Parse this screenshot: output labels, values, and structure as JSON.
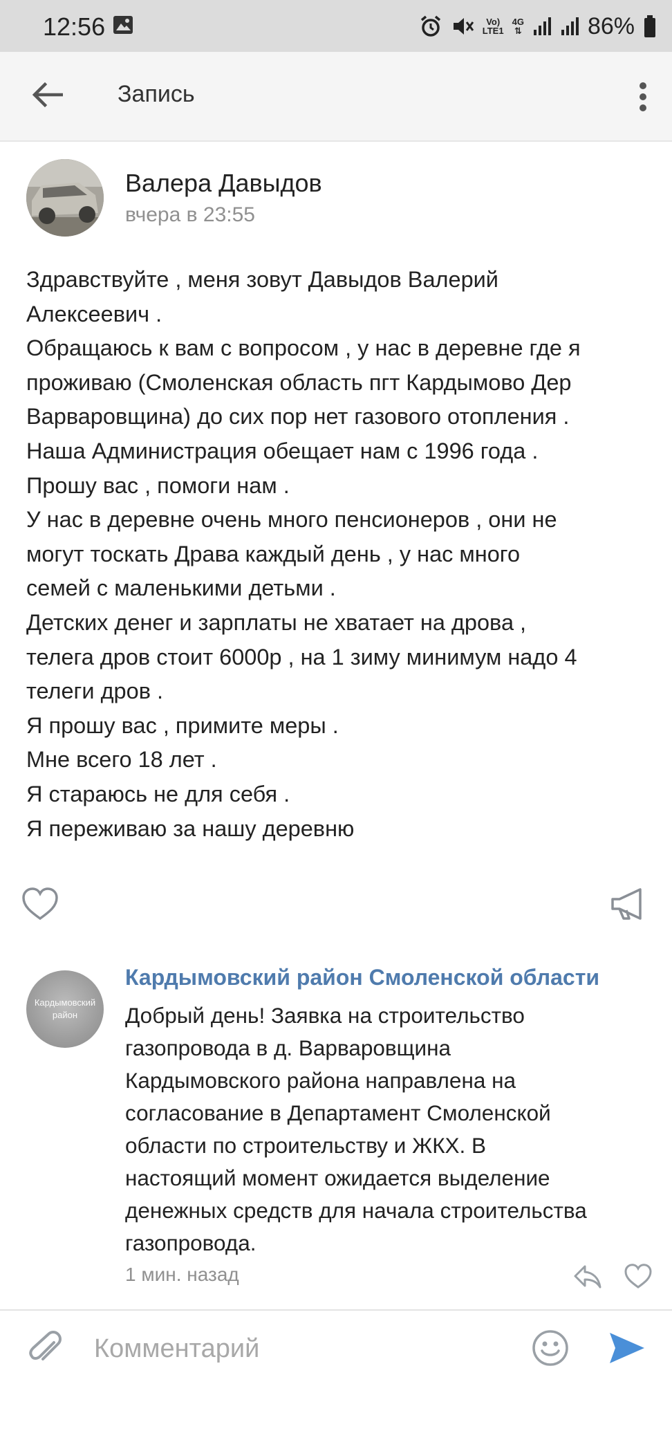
{
  "status_bar": {
    "time": "12:56",
    "network_lte_top": "Vo)",
    "network_lte_bottom": "LTE1",
    "network_gen": "4G",
    "battery": "86%"
  },
  "appbar": {
    "title": "Запись",
    "back_icon": "arrow-left-icon",
    "more_icon": "more-vertical-icon"
  },
  "post": {
    "author": "Валера Давыдов",
    "time": "вчера в 23:55",
    "text": "Здравствуйте , меня зовут Давыдов Валерий\nАлексеевич .\nОбращаюсь к вам с вопросом ,  у нас в деревне где я\nпроживаю (Смоленская область пгт Кардымово Дер\nВарваровщина) до сих пор нет газового отопления .\nНаша Администрация обещает нам с 1996 года .\nПрошу вас , помоги нам .\nУ нас в деревне очень много пенсионеров , они не\nмогут тоскать Драва каждый день , у нас много\nсемей с маленькими детьми .\nДетских денег и зарплаты не хватает на дрова ,\nтелега дров стоит 6000р , на 1 зиму минимум надо 4\nтелеги дров .\nЯ прошу вас , примите меры .\nМне всего 18 лет .\n Я стараюсь не для себя .\nЯ переживаю за нашу деревню",
    "like_icon": "heart-icon",
    "share_icon": "megaphone-icon"
  },
  "comment": {
    "author": "Кардымовский район Смоленской области",
    "avatar_text": "Кардымовский\nрайон",
    "text": "Добрый день! Заявка на строительство\nгазопровода в д. Варваровщина\nКардымовского района направлена на\nсогласование в Департамент Смоленской\nобласти по строительству и ЖКХ. В\nнастоящий момент ожидается выделение\nденежных средств для начала строительства\nгазопровода.",
    "time": "1 мин. назад",
    "reply_icon": "reply-icon",
    "like_icon": "heart-icon"
  },
  "composer": {
    "placeholder": "Комментарий",
    "attach_icon": "paperclip-icon",
    "emoji_icon": "smiley-icon",
    "send_icon": "send-icon"
  },
  "colors": {
    "link": "#4f7bad",
    "send": "#4a8fd8",
    "muted": "#909090",
    "statusbar_bg": "#dcdcdc",
    "appbar_bg": "#f5f5f5"
  }
}
